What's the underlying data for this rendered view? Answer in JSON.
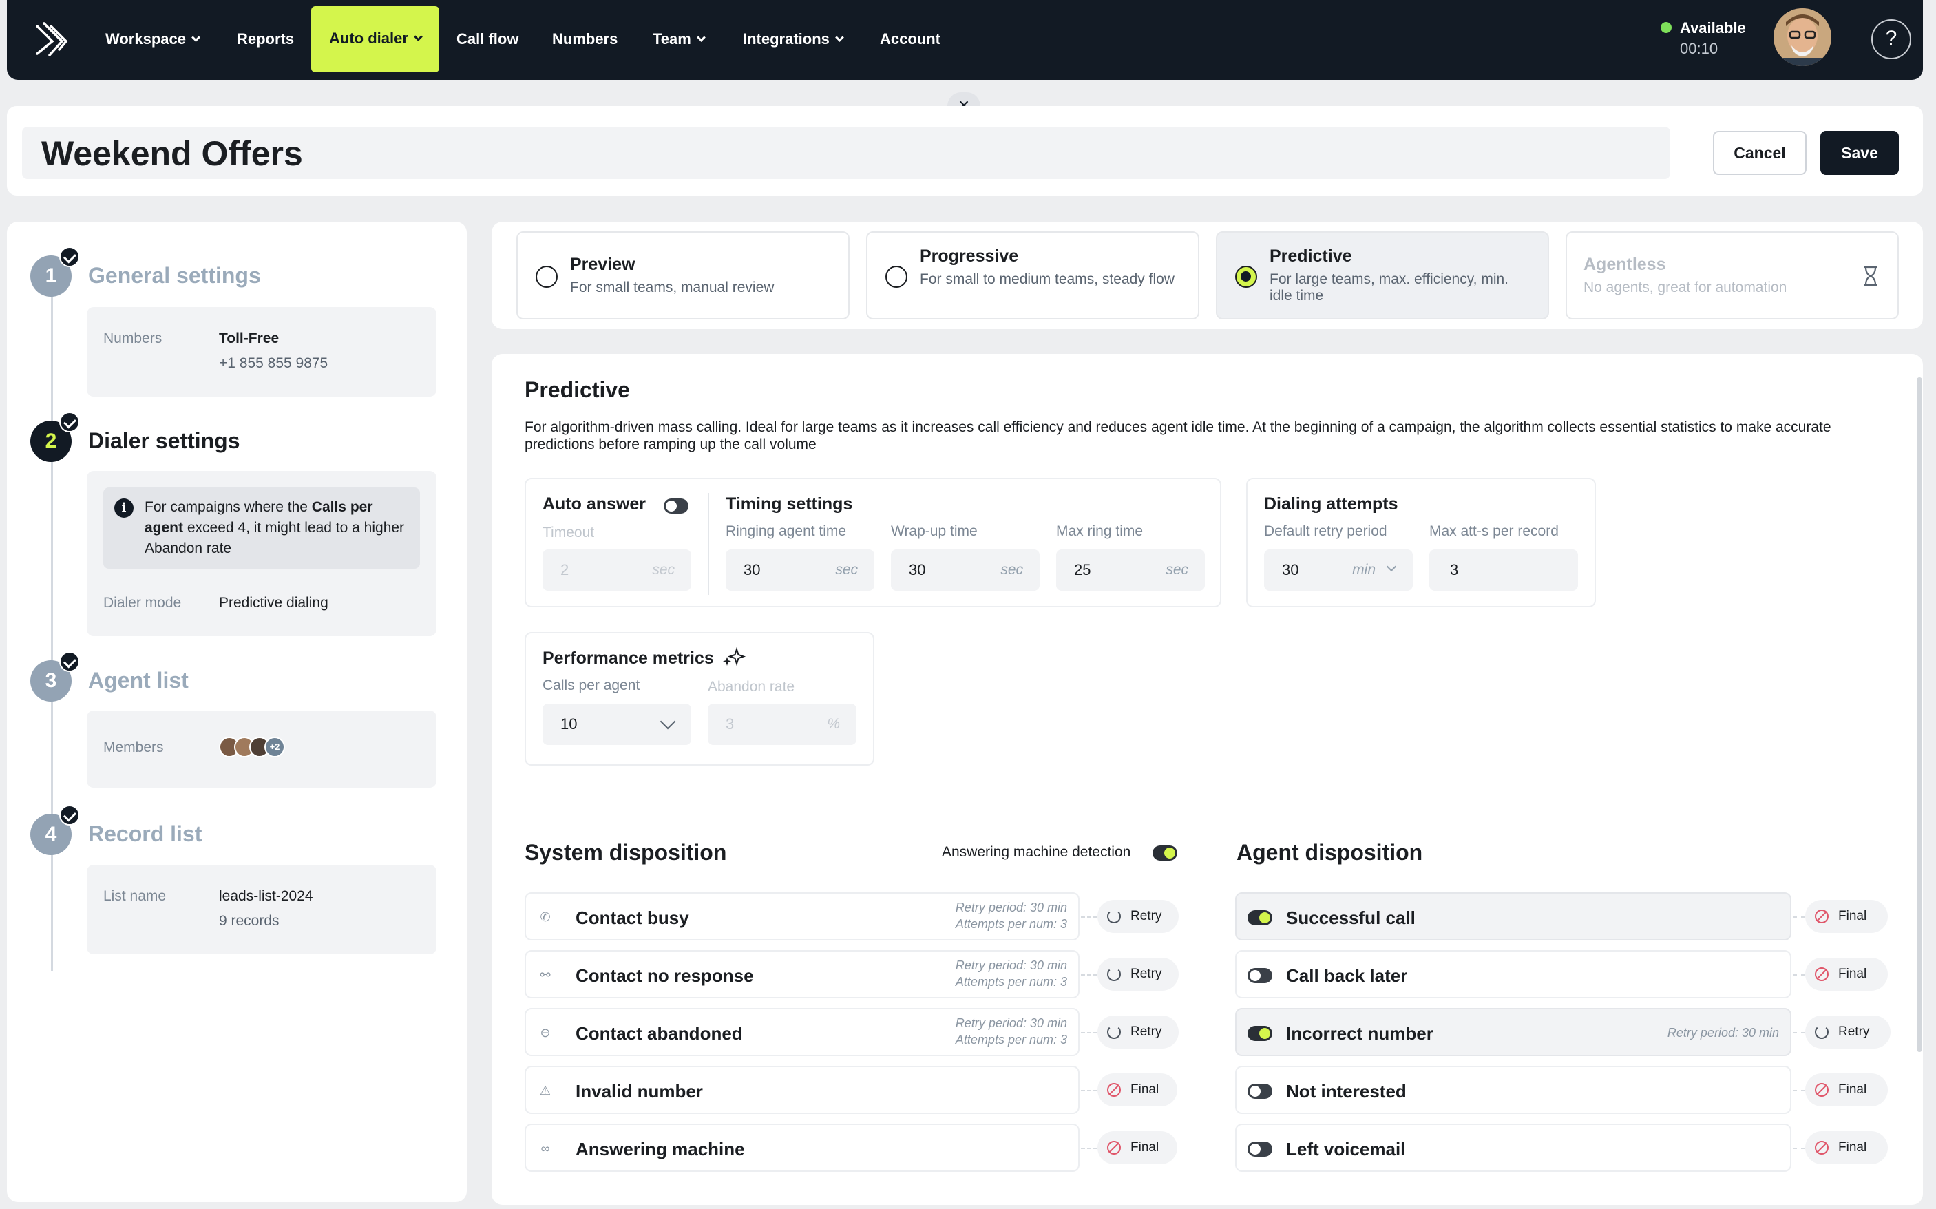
{
  "nav": {
    "items": [
      {
        "label": "Workspace",
        "dropdown": true
      },
      {
        "label": "Reports",
        "dropdown": false
      },
      {
        "label": "Auto dialer",
        "dropdown": true,
        "active": true
      },
      {
        "label": "Call flow",
        "dropdown": false
      },
      {
        "label": "Numbers",
        "dropdown": false
      },
      {
        "label": "Team",
        "dropdown": true
      },
      {
        "label": "Integrations",
        "dropdown": true
      },
      {
        "label": "Account",
        "dropdown": false
      }
    ],
    "status": {
      "label": "Available",
      "time": "00:10",
      "color": "#7ee05a"
    },
    "help_icon": "?"
  },
  "close_icon": "×",
  "header": {
    "title": "Weekend Offers",
    "cancel_label": "Cancel",
    "save_label": "Save"
  },
  "steps": [
    {
      "num": "1",
      "title": "General settings",
      "done": true,
      "fields": [
        {
          "label": "Numbers",
          "value": "Toll-Free",
          "sub": "+1 855 855 9875"
        }
      ]
    },
    {
      "num": "2",
      "title": "Dialer settings",
      "done": true,
      "info": {
        "pre": "For campaigns where the ",
        "bold": "Calls per agent",
        "post": " exceed 4, it might lead to a higher Abandon rate"
      },
      "fields": [
        {
          "label": "Dialer mode",
          "value": "Predictive dialing"
        }
      ]
    },
    {
      "num": "3",
      "title": "Agent list",
      "done": true,
      "fields": [
        {
          "label": "Members",
          "extra": "+2"
        }
      ]
    },
    {
      "num": "4",
      "title": "Record list",
      "done": true,
      "fields": [
        {
          "label": "List name",
          "value": "leads-list-2024",
          "sub": "9 records"
        }
      ]
    }
  ],
  "modes": [
    {
      "title": "Preview",
      "desc": "For small teams, manual review",
      "selected": false,
      "disabled": false
    },
    {
      "title": "Progressive",
      "desc": "For small to medium teams, steady flow",
      "selected": false,
      "disabled": false
    },
    {
      "title": "Predictive",
      "desc": "For large teams, max. efficiency, min. idle time",
      "selected": true,
      "disabled": false
    },
    {
      "title": "Agentless",
      "desc": "No agents, great for automation",
      "selected": false,
      "disabled": true,
      "icon": "hourglass-icon"
    }
  ],
  "main": {
    "title": "Predictive",
    "description": "For algorithm-driven mass calling. Ideal for large teams as it increases call efficiency and reduces agent idle time. At the beginning of a campaign, the algorithm collects essential statistics to make accurate predictions before ramping up the call volume",
    "auto_answer": {
      "label": "Auto answer",
      "enabled": false,
      "timeout_label": "Timeout",
      "timeout_value": "2",
      "unit": "sec"
    },
    "timing": {
      "label": "Timing settings",
      "fields": [
        {
          "label": "Ringing agent time",
          "value": "30",
          "unit": "sec"
        },
        {
          "label": "Wrap-up time",
          "value": "30",
          "unit": "sec"
        },
        {
          "label": "Max ring time",
          "value": "25",
          "unit": "sec"
        }
      ]
    },
    "dialing": {
      "label": "Dialing attempts",
      "retry_label": "Default retry period",
      "retry_value": "30",
      "retry_unit": "min",
      "max_label": "Max att-s per record",
      "max_value": "3"
    },
    "performance": {
      "label": "Performance metrics",
      "calls_label": "Calls per agent",
      "calls_value": "10",
      "abandon_label": "Abandon rate",
      "abandon_value": "3",
      "abandon_unit": "%"
    }
  },
  "system_disposition": {
    "title": "System disposition",
    "amd_label": "Answering machine detection",
    "amd_enabled": true,
    "rows": [
      {
        "icon": "phone-busy-icon",
        "name": "Contact busy",
        "meta1": "Retry period: 30 min",
        "meta2": "Attempts per num: 3",
        "action": "Retry"
      },
      {
        "icon": "no-response-icon",
        "name": "Contact no response",
        "meta1": "Retry period: 30 min",
        "meta2": "Attempts per num: 3",
        "action": "Retry"
      },
      {
        "icon": "abandoned-icon",
        "name": "Contact abandoned",
        "meta1": "Retry period: 30 min",
        "meta2": "Attempts per num: 3",
        "action": "Retry"
      },
      {
        "icon": "invalid-number-icon",
        "name": "Invalid number",
        "meta1": "",
        "meta2": "",
        "action": "Final"
      },
      {
        "icon": "voicemail-icon",
        "name": "Answering machine",
        "meta1": "",
        "meta2": "",
        "action": "Final"
      }
    ]
  },
  "agent_disposition": {
    "title": "Agent disposition",
    "rows": [
      {
        "name": "Successful call",
        "enabled": true,
        "meta": "",
        "action": "Final"
      },
      {
        "name": "Call back later",
        "enabled": false,
        "meta": "",
        "action": "Final"
      },
      {
        "name": "Incorrect number",
        "enabled": true,
        "meta": "Retry period: 30 min",
        "action": "Retry"
      },
      {
        "name": "Not interested",
        "enabled": false,
        "meta": "",
        "action": "Final"
      },
      {
        "name": "Left voicemail",
        "enabled": false,
        "meta": "",
        "action": "Final"
      }
    ]
  },
  "colors": {
    "accent": "#d4f54c",
    "nav_bg": "#121a24",
    "final": "#e0566a"
  }
}
